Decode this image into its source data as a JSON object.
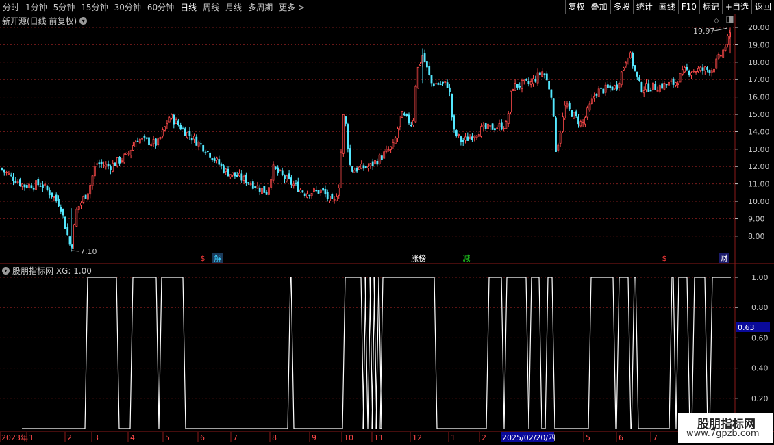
{
  "toolbar": {
    "periods": [
      "分时",
      "1分钟",
      "5分钟",
      "15分钟",
      "30分钟",
      "60分钟",
      "日线",
      "周线",
      "月线",
      "多周期",
      "更多 >"
    ],
    "active_period": "日线",
    "right_buttons": [
      "复权",
      "叠加",
      "多股",
      "统计",
      "画线",
      "F10",
      "+自选",
      "返回"
    ],
    "mark_label": "标记"
  },
  "main_panel": {
    "title": "新开源(日线 前复权)",
    "max_label": "19.97",
    "min_label": "7.10",
    "price_axis": [
      "20.00",
      "19.00",
      "18.00",
      "17.00",
      "16.00",
      "15.00",
      "14.00",
      "13.00",
      "12.00",
      "11.00",
      "10.00",
      "9.00",
      "8.00"
    ],
    "events": [
      {
        "label": "$",
        "color": "#ff3b3b"
      },
      {
        "label": "解",
        "color": "#3bd0ff"
      },
      {
        "label": "涨榜",
        "color": "#ffffff"
      },
      {
        "label": "减",
        "color": "#22dd22"
      },
      {
        "label": "$",
        "color": "#ff3b3b"
      },
      {
        "label": "财",
        "color": "#ffffff"
      }
    ]
  },
  "indicator_panel": {
    "title": "股朋指标网 XG: 1.00",
    "axis": [
      "1.00",
      "0.80",
      "0.60",
      "0.40",
      "0.20"
    ],
    "cursor_value": "0.63"
  },
  "date_axis": {
    "labels": [
      "2023年",
      "1",
      "2",
      "3",
      "4",
      "5",
      "6",
      "7",
      "8",
      "9",
      "10",
      "11",
      "12",
      "1",
      "2",
      "5",
      "6",
      "7"
    ],
    "highlight_date": "2025/02/20/四"
  },
  "watermark": {
    "cn": "股朋指标网",
    "url": "www.7gpzb.com"
  },
  "colors": {
    "up": "#ff4a4a",
    "down": "#54e8ff",
    "grid": "#7a1b1b",
    "panel_border": "#8b1a1a",
    "line": "#ffffff"
  },
  "chart_data": {
    "type": "candlestick",
    "y_range": [
      7.1,
      19.97
    ],
    "indicator": {
      "name": "XG",
      "range": [
        0,
        1
      ],
      "value": 1.0,
      "levels": [
        0,
        1
      ]
    }
  }
}
